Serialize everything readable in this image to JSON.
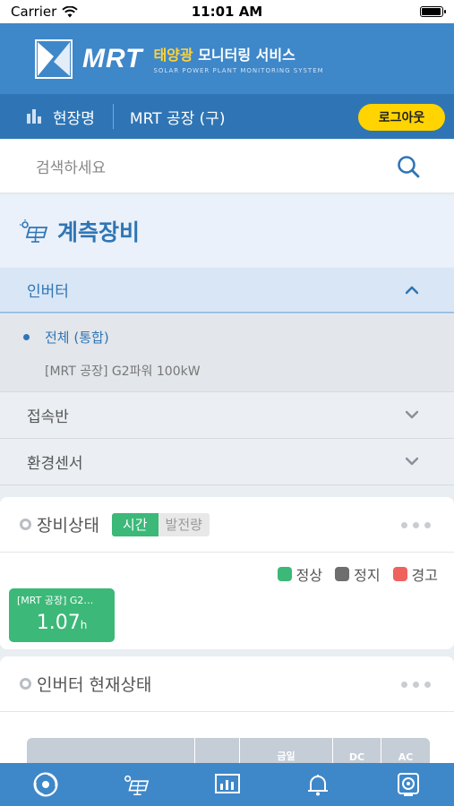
{
  "status_bar": {
    "carrier": "Carrier",
    "time": "11:01 AM",
    "battery_level": 1.0
  },
  "header": {
    "logo_text": "MRT",
    "service_highlight": "태양광",
    "service_rest": " 모니터링 서비스",
    "service_en": "SOLAR POWER PLANT MONITORING SYSTEM"
  },
  "site_bar": {
    "label": "현장명",
    "site_name": "MRT 공장 (구)",
    "logout_label": "로그아웃"
  },
  "search": {
    "placeholder": "검색하세요"
  },
  "equipment": {
    "title": "계측장비",
    "inverter": {
      "label": "인버터",
      "items": [
        "전체 (통합)",
        "[MRT 공장] G2파워 100kW"
      ]
    },
    "sections": [
      "접속반",
      "환경센서"
    ]
  },
  "status_card": {
    "title": "장비상태",
    "toggle": {
      "active": "시간",
      "inactive": "발전량"
    },
    "legend": [
      {
        "label": "정상",
        "color": "#3cb878"
      },
      {
        "label": "정지",
        "color": "#6e6e6e"
      },
      {
        "label": "경고",
        "color": "#f0625d"
      }
    ],
    "tile": {
      "name": "[MRT 공장] G2…",
      "value": "1.07",
      "unit": "h"
    }
  },
  "inverter_card": {
    "title": "인버터 현재상태",
    "columns": [
      "",
      "",
      "금일",
      "DC",
      "AC"
    ]
  },
  "colors": {
    "primary": "#3e87c9",
    "dark_primary": "#2f75b5",
    "accent": "#ffd400",
    "normal": "#3cb878"
  },
  "tab_bar": [
    "dashboard-icon",
    "equipment-icon",
    "report-icon",
    "alarm-icon",
    "settings-icon"
  ]
}
